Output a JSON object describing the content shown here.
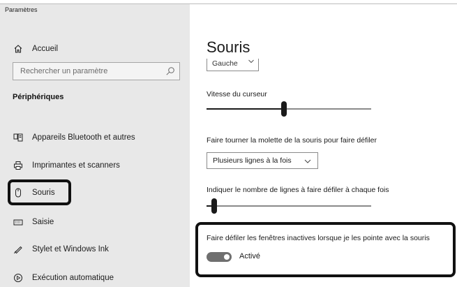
{
  "window": {
    "title": "Paramètres"
  },
  "sidebar": {
    "home": {
      "label": "Accueil",
      "icon": "home-icon"
    },
    "search": {
      "placeholder": "Rechercher un paramètre",
      "icon": "search-icon"
    },
    "section_heading": "Périphériques",
    "items": [
      {
        "label": "Appareils Bluetooth et autres",
        "icon": "bluetooth-devices-icon"
      },
      {
        "label": "Imprimantes et scanners",
        "icon": "printer-icon"
      },
      {
        "label": "Souris",
        "icon": "mouse-icon",
        "selected": true
      },
      {
        "label": "Saisie",
        "icon": "keyboard-icon"
      },
      {
        "label": "Stylet et Windows Ink",
        "icon": "pen-icon"
      },
      {
        "label": "Exécution automatique",
        "icon": "autoplay-icon"
      }
    ]
  },
  "main": {
    "title": "Souris",
    "primary_button": {
      "value": "Gauche"
    },
    "cursor_speed": {
      "label": "Vitesse du curseur",
      "value_fraction": 0.47
    },
    "scroll_mode": {
      "label": "Faire tourner la molette de la souris pour faire défiler",
      "value": "Plusieurs lignes à la fois"
    },
    "lines_to_scroll": {
      "label": "Indiquer le nombre de lignes à faire défiler à chaque fois",
      "value_fraction": 0.03
    },
    "inactive_scroll": {
      "label": "Faire défiler les fenêtres inactives lorsque je les pointe avec la souris",
      "state_label": "Activé",
      "on": true
    }
  },
  "colors": {
    "sidebar_bg": "#e8e8e8",
    "highlight_border": "#111111",
    "toggle_on": "#6f6f6f"
  }
}
